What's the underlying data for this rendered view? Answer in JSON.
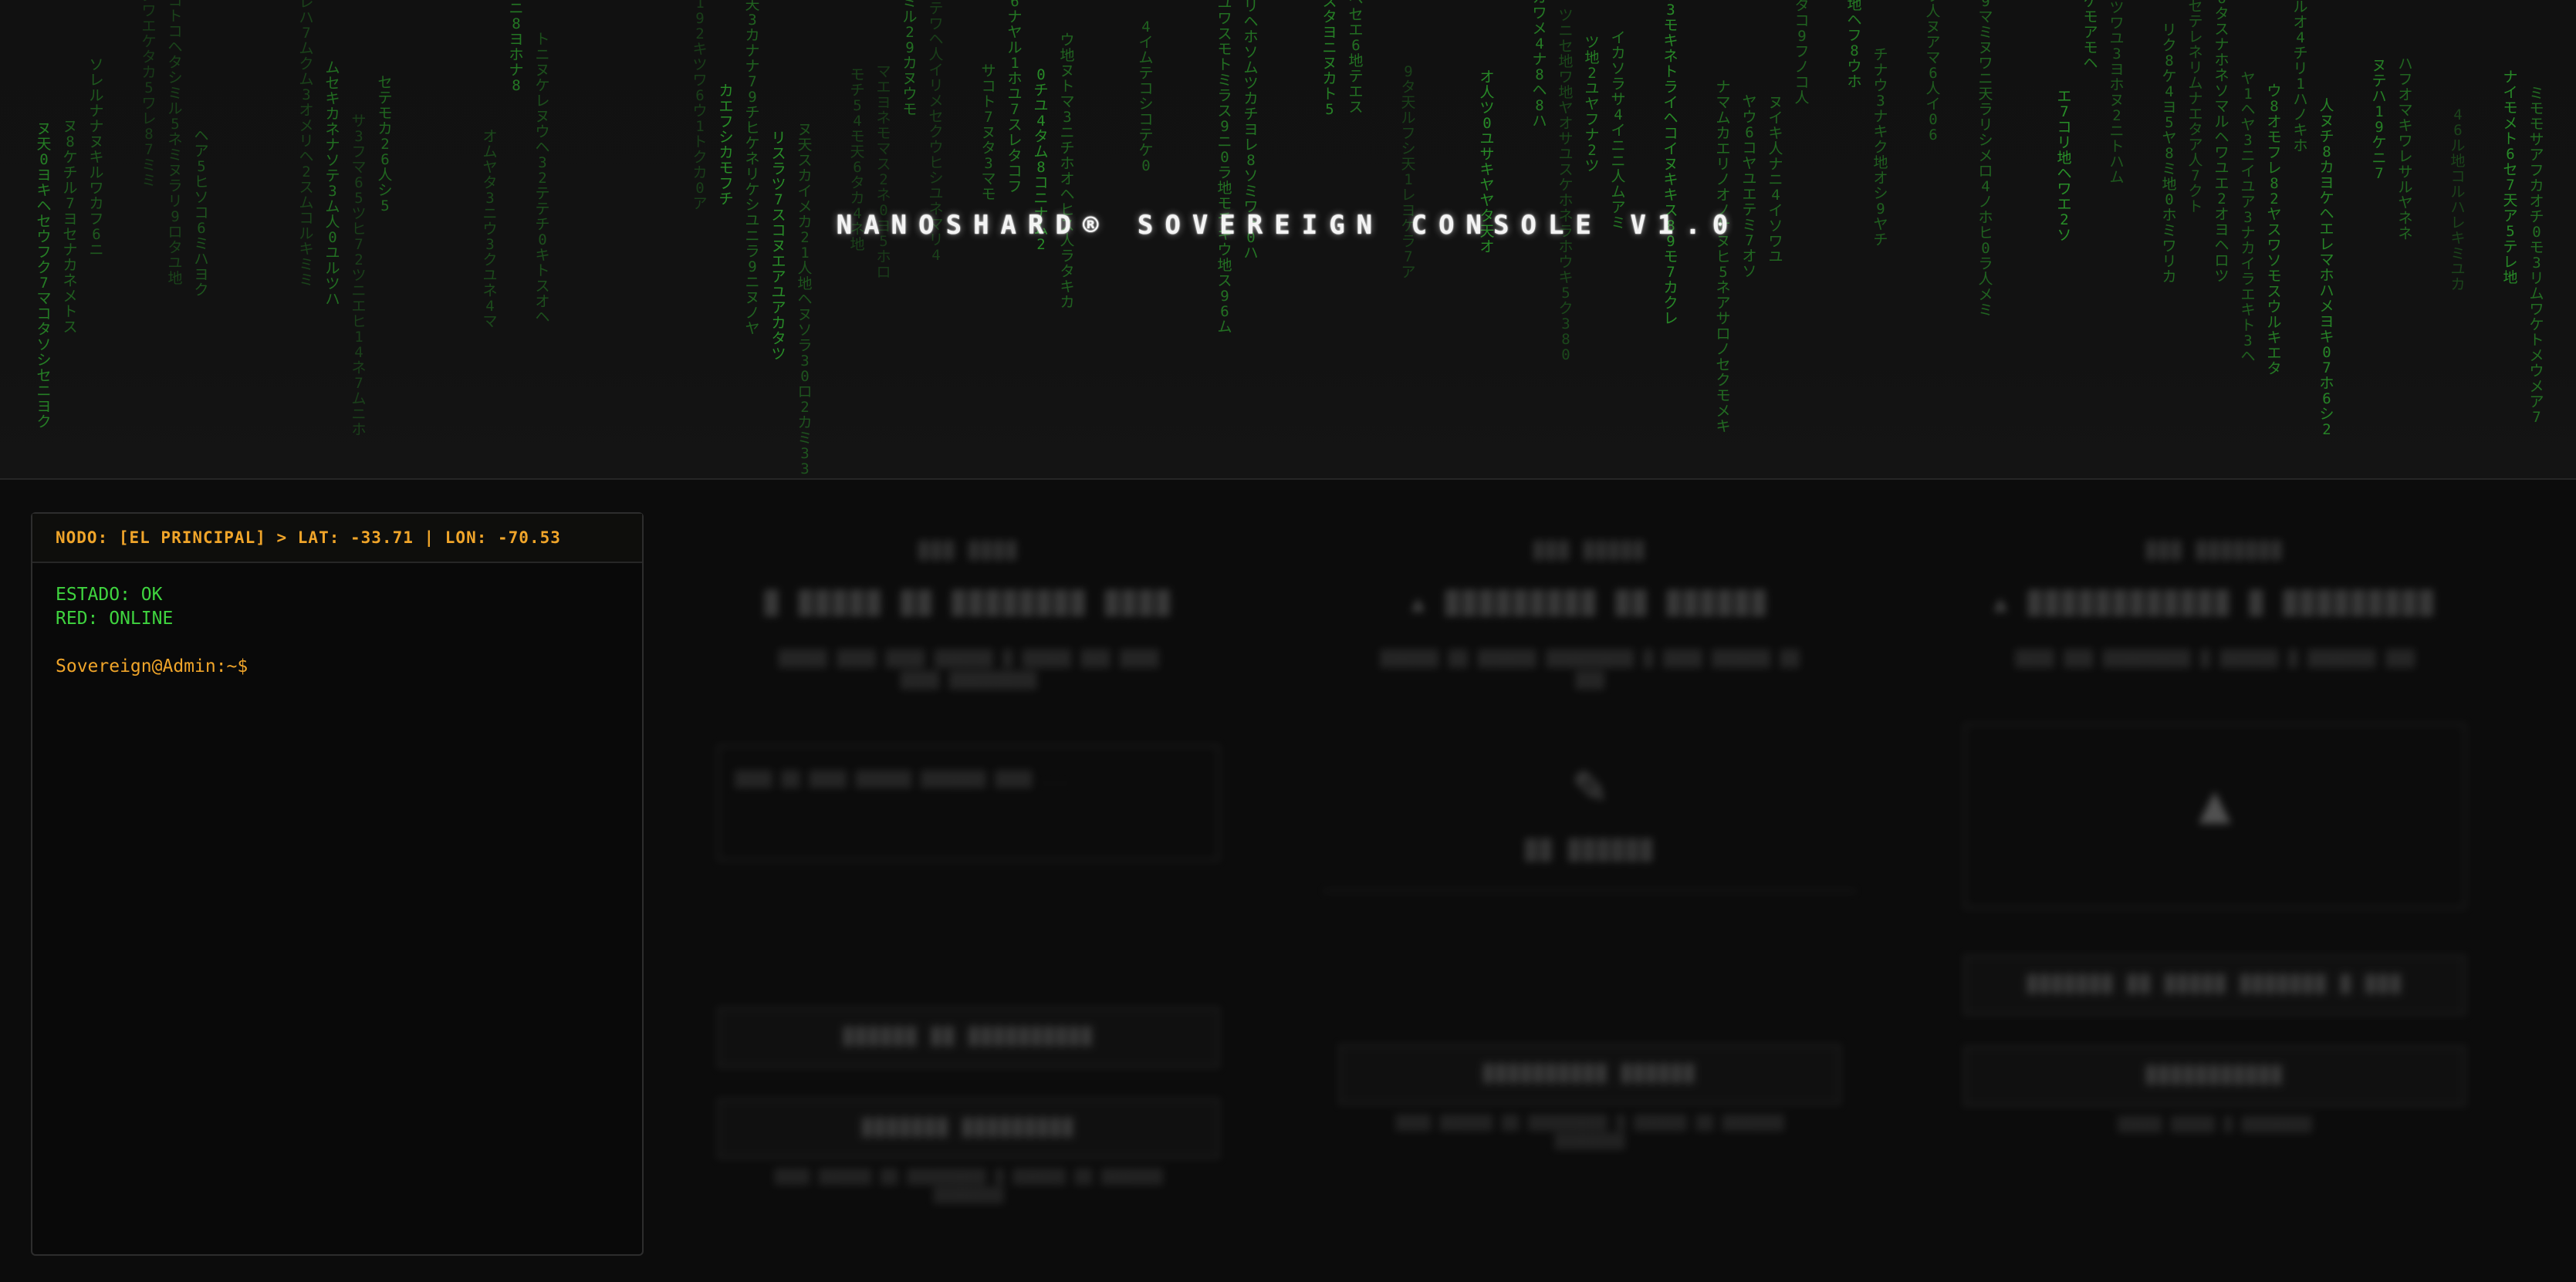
{
  "app": {
    "title": "NANOSHARD® SOVEREIGN CONSOLE V1.0"
  },
  "terminal": {
    "header": "NODO: [EL PRINCIPAL] > LAT: -33.71 | LON: -70.53",
    "status_lines": [
      "ESTADO: OK",
      "RED: ONLINE"
    ],
    "prompt": "Sovereign@Admin:~$"
  },
  "theme": {
    "terminal_accent": "#f0a52a",
    "terminal_ok": "#3fd43f",
    "rain_color": "#2fb32f",
    "background": "#0c0c0c"
  },
  "matrix_glyphs": "アイウエオカキクケコサシスセソタチツテトナニヌネノハヒフヘホマミムメモヤユヨラリルレロワ天地人0123456789"
}
